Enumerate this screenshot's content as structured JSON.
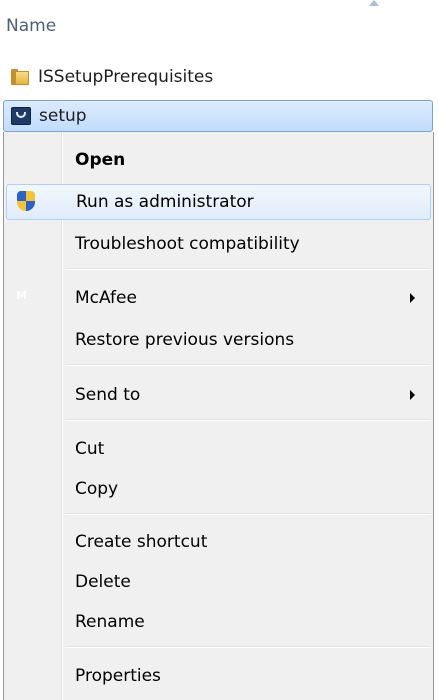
{
  "header": {
    "name_column": "Name"
  },
  "files": [
    {
      "name": "ISSetupPrerequisites",
      "icon": "folder-icon"
    },
    {
      "name": "setup",
      "icon": "setup-icon",
      "selected": true
    }
  ],
  "menu": {
    "open": "Open",
    "run_as_admin": "Run as administrator",
    "troubleshoot": "Troubleshoot compatibility",
    "mcafee": "McAfee",
    "restore": "Restore previous versions",
    "send_to": "Send to",
    "cut": "Cut",
    "copy": "Copy",
    "create_shortcut": "Create shortcut",
    "delete": "Delete",
    "rename": "Rename",
    "properties": "Properties"
  },
  "colors": {
    "selection": "#c1dcfc",
    "hover": "#e0ecfa",
    "menu_bg": "#f0f0f0",
    "header_text": "#4c607a"
  }
}
